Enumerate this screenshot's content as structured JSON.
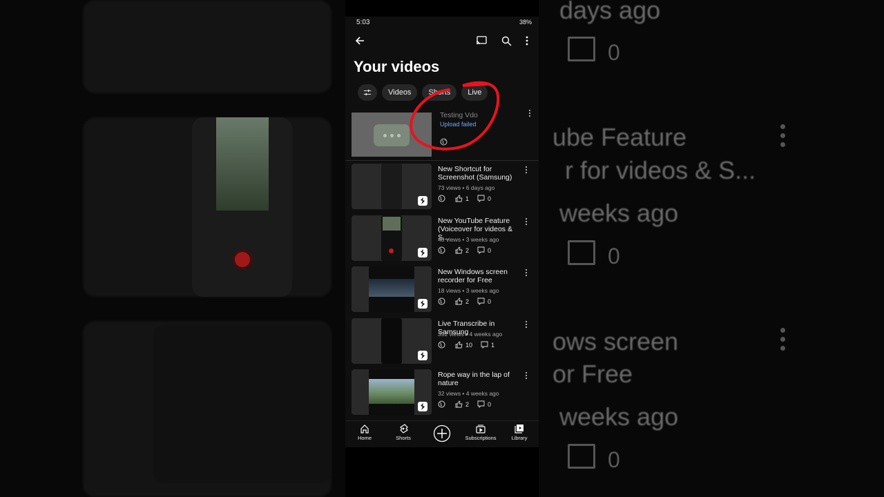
{
  "status_bar": {
    "time": "5:03",
    "right_text": "38%"
  },
  "page": {
    "title": "Your videos"
  },
  "chips": [
    {
      "label": "Videos"
    },
    {
      "label": "Shorts"
    },
    {
      "label": "Live"
    }
  ],
  "failed_upload": {
    "title": "Testing Vdo",
    "status": "Upload failed"
  },
  "videos": [
    {
      "title": "New Shortcut for Screenshot (Samsung)",
      "meta": "73 views • 6 days ago",
      "likes": "1",
      "comments": "0"
    },
    {
      "title": "New YouTube Feature (Voiceover for videos & S...",
      "meta": "48 views • 3 weeks ago",
      "likes": "2",
      "comments": "0"
    },
    {
      "title": "New Windows screen recorder for Free",
      "meta": "18 views • 3 weeks ago",
      "likes": "2",
      "comments": "0"
    },
    {
      "title": "Live Transcribe in Samsung",
      "meta": "392 views • 4 weeks ago",
      "likes": "10",
      "comments": "1"
    },
    {
      "title": "Rope way in the lap of nature",
      "meta": "32 views • 4 weeks ago",
      "likes": "2",
      "comments": "0"
    }
  ],
  "nav": [
    {
      "label": "Home",
      "icon": "home-icon"
    },
    {
      "label": "Shorts",
      "icon": "shorts-icon"
    },
    {
      "label": "",
      "icon": "create-icon"
    },
    {
      "label": "Subscriptions",
      "icon": "subscriptions-icon"
    },
    {
      "label": "Library",
      "icon": "library-icon"
    }
  ],
  "backdrop_right": {
    "line1": "days ago",
    "count1": "0",
    "line2": "ube Feature",
    "line3": "r for videos & S...",
    "line4": "weeks ago",
    "count2": "0",
    "line5": "ows screen",
    "line6": "or Free",
    "line7": "weeks ago",
    "count3": "0"
  },
  "colors": {
    "accent_link": "#6ea8fe",
    "annotation": "#e8141e",
    "background": "#0f0f0f"
  }
}
